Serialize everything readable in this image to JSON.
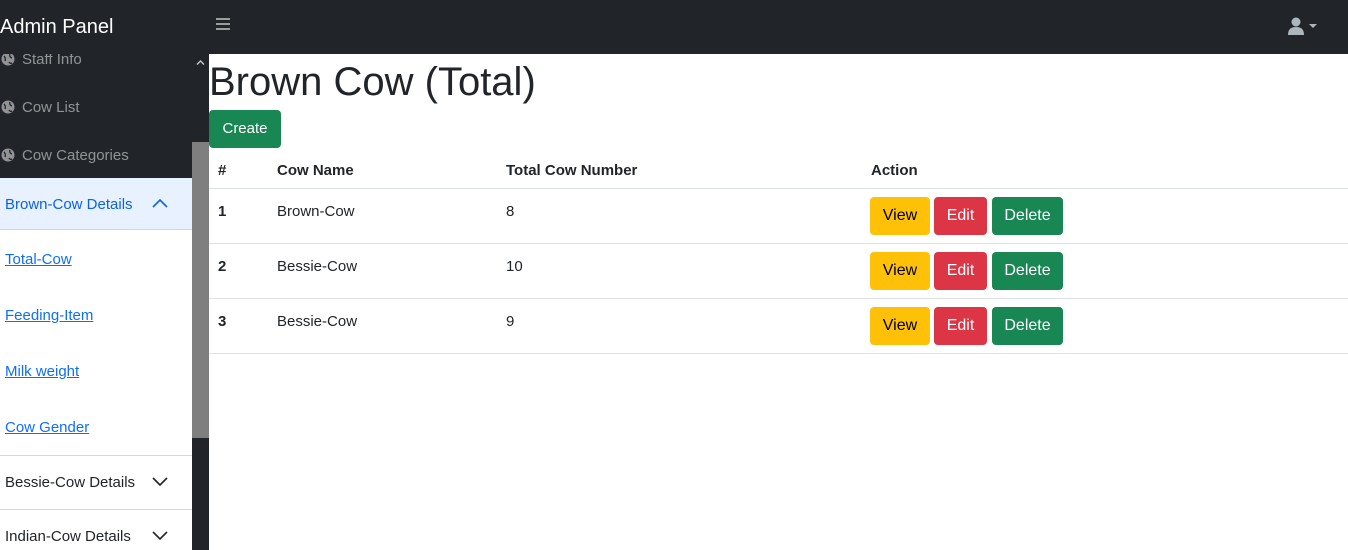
{
  "navbar": {
    "brand": "Admin Panel"
  },
  "sidebar": {
    "links": [
      {
        "label": "Staff Info",
        "icon": "globe-icon"
      },
      {
        "label": "Cow List",
        "icon": "globe-icon"
      },
      {
        "label": "Cow Categories",
        "icon": "globe-icon"
      }
    ],
    "sections": [
      {
        "label": "Brown-Cow Details",
        "expanded": true,
        "items": [
          "Total-Cow",
          "Feeding-Item",
          "Milk weight",
          "Cow Gender"
        ]
      },
      {
        "label": "Bessie-Cow Details",
        "expanded": false
      },
      {
        "label": "Indian-Cow Details",
        "expanded": false
      }
    ]
  },
  "main": {
    "title": "Brown Cow (Total)",
    "create_label": "Create",
    "table": {
      "headers": [
        "#",
        "Cow Name",
        "Total Cow Number",
        "Action"
      ],
      "rows": [
        {
          "index": "1",
          "name": "Brown-Cow",
          "total": "8"
        },
        {
          "index": "2",
          "name": "Bessie-Cow",
          "total": "10"
        },
        {
          "index": "3",
          "name": "Bessie-Cow",
          "total": "9"
        }
      ],
      "actions": {
        "view": "View",
        "edit": "Edit",
        "delete": "Delete"
      }
    }
  },
  "colors": {
    "navbar_bg": "#212529",
    "accordion_active_bg": "#e7f1ff",
    "accordion_active_text": "#0c63e4",
    "link": "#0d6efd",
    "success": "#198754",
    "warning": "#ffc107",
    "danger": "#dc3545"
  }
}
